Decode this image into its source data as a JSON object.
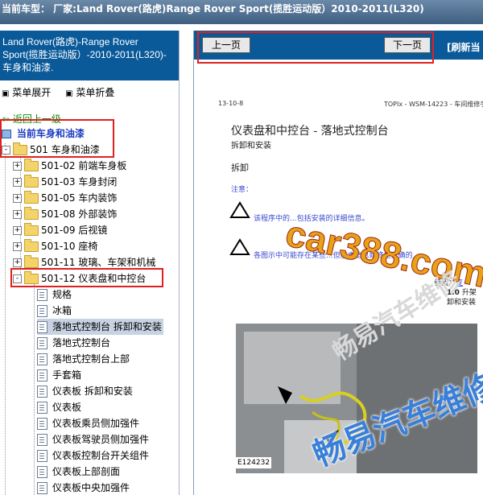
{
  "topbar": {
    "title": "当前车型： 厂家:Land Rover(路虎)Range Rover Sport(揽胜运动版）2010-2011(L320)"
  },
  "left": {
    "header": "Land Rover(路虎)-Range Rover Sport(揽胜运动版）-2010-2011(L320)- 车身和油漆.",
    "menu_expand": "菜单展开",
    "menu_collapse": "菜单折叠",
    "back": "返回上一级",
    "current_label": "当前",
    "current_value": "车身和油漆",
    "root": "501 车身和油漆",
    "folders": [
      "501-02 前端车身板",
      "501-03 车身封闭",
      "501-05 车内装饰",
      "501-08 外部装饰",
      "501-09 后视镜",
      "501-10 座椅",
      "501-11 玻璃、车架和机械",
      "501-12 仪表盘和中控台"
    ],
    "docs": [
      "规格",
      "冰箱",
      "落地式控制台 拆卸和安装",
      "落地式控制台",
      "落地式控制台上部",
      "手套箱",
      "仪表板 拆卸和安装",
      "仪表板",
      "仪表板乘员侧加强件",
      "仪表板驾驶员侧加强件",
      "仪表板控制台开关组件",
      "仪表板上部剖面",
      "仪表板中央加强件"
    ]
  },
  "nav": {
    "prev": "上一页",
    "next": "下一页",
    "refresh": "[刷新当"
  },
  "doc": {
    "page_no": "13-10-8",
    "header_right": "TOPIx - WSM-14223 - 车间维修手",
    "title": "仪表盘和中控台 - 落地式控制台",
    "subtitle": "拆卸和安装",
    "section": "拆卸",
    "note_label": "注意：",
    "warn1": "该程序中的...包括安装的详细信息。",
    "warn2": "各图示中可能存在某些...但基本信息始终是正确的",
    "ref_label": "参阅：",
    "ref_link": "变",
    "step_num": "1.0",
    "step_text": "升架",
    "step_text2": "卸和安装",
    "figure_id": "E124232"
  },
  "watermark": {
    "site": "car388.com",
    "brand": "畅易汽车维修",
    "faint": "畅易汽车维修"
  }
}
